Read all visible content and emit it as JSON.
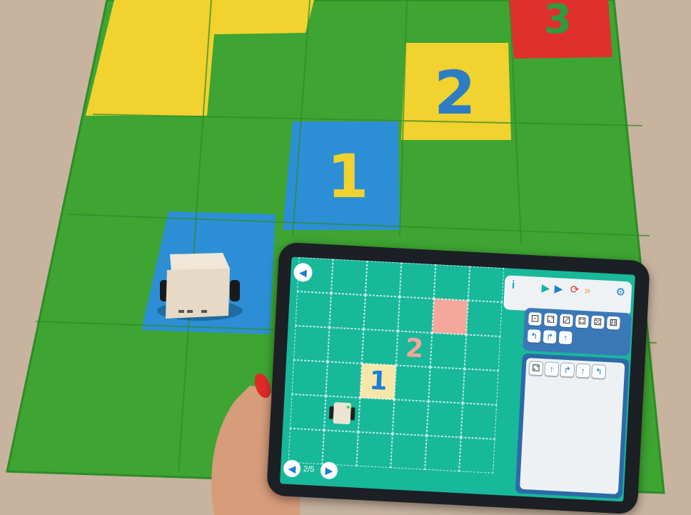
{
  "mat": {
    "tile_labels": [
      "1",
      "2",
      "3"
    ]
  },
  "tablet": {
    "board_labels": [
      "1",
      "2"
    ],
    "page_indicator": "2/5",
    "info_label": "i",
    "icons": {
      "back": "arrow-left-icon",
      "prev": "arrow-left-icon",
      "next": "arrow-right-icon",
      "play": "play-icon",
      "step": "step-icon",
      "reset": "reset-icon",
      "fast": "fast-forward-icon",
      "settings": "gear-icon"
    },
    "block_palette": {
      "dice": [
        "die-1",
        "die-2",
        "die-3",
        "die-4",
        "die-5",
        "die-6"
      ],
      "moves": [
        "turn-left",
        "turn-right",
        "forward"
      ]
    },
    "program": [
      "die",
      "forward",
      "turn-right",
      "forward",
      "turn-left"
    ]
  },
  "colors": {
    "mat_green": "#3ea532",
    "mat_yellow": "#f2d22f",
    "mat_blue": "#2c8fd6",
    "mat_red": "#e0302e",
    "screen_teal": "#18b89a",
    "target_pink": "#f4a79a",
    "accent_blue": "#1a7fd6"
  }
}
